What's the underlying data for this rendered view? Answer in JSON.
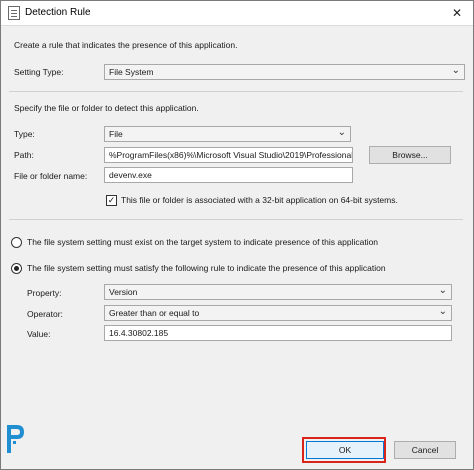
{
  "window": {
    "title": "Detection Rule"
  },
  "intro": "Create a rule that indicates the presence of this application.",
  "setting_type": {
    "label": "Setting Type:",
    "value": "File System"
  },
  "file_section": {
    "heading": "Specify the file or folder to detect this application.",
    "type": {
      "label": "Type:",
      "value": "File"
    },
    "path": {
      "label": "Path:",
      "value": "%ProgramFiles(x86)%\\Microsoft Visual Studio\\2019\\Professional\\C",
      "browse_label": "Browse..."
    },
    "name": {
      "label": "File or folder name:",
      "value": "devenv.exe"
    },
    "x64": {
      "label": "This file or folder is associated with a 32-bit application on 64-bit systems.",
      "checked": true
    }
  },
  "options": {
    "exist_label": "The file system setting must exist on the target system to indicate presence of this application",
    "rule_label": "The file system setting must satisfy the following rule to indicate the presence of this application"
  },
  "rule": {
    "property": {
      "label": "Property:",
      "value": "Version"
    },
    "operator": {
      "label": "Operator:",
      "value": "Greater than or equal to"
    },
    "value": {
      "label": "Value:",
      "value": "16.4.30802.185"
    }
  },
  "buttons": {
    "ok": "OK",
    "cancel": "Cancel"
  },
  "icons": {
    "check": "✓",
    "chevron": "⌄",
    "close": "✕"
  },
  "colors": {
    "highlight": "#d9241c",
    "logo": "#1f8fd1"
  }
}
